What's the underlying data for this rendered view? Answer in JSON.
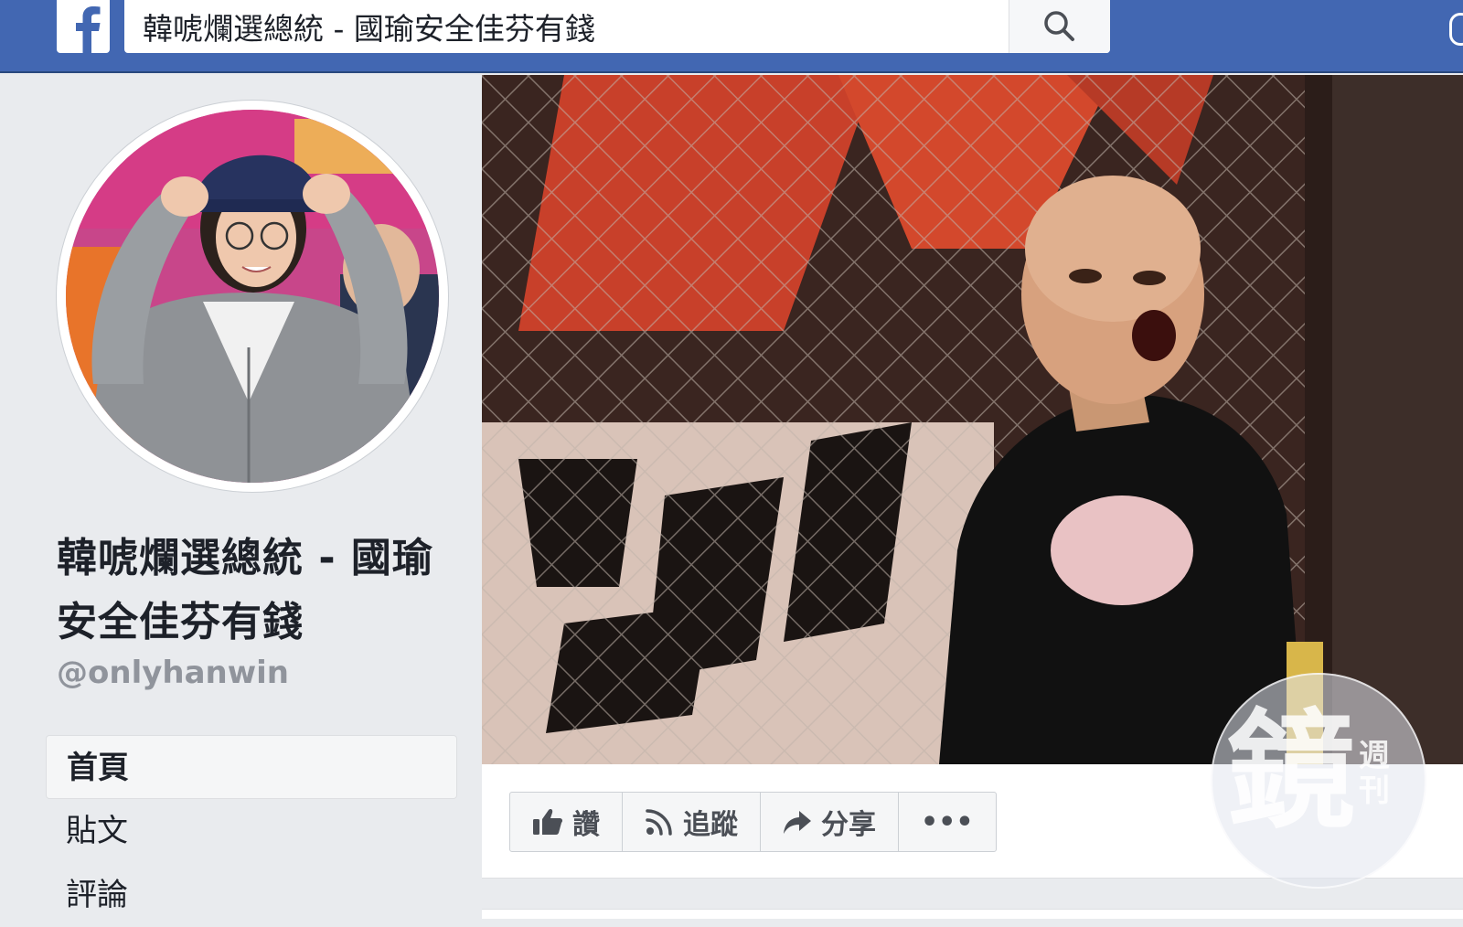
{
  "colors": {
    "brand": "#4267b2",
    "page_bg": "#e9ebee",
    "text": "#1d2129",
    "muted": "#90949c"
  },
  "topbar": {
    "logo_icon": "facebook-logo-icon",
    "search_value": "韓唬爛選總統 - 國瑜安全佳芬有錢",
    "search_icon": "search-icon"
  },
  "page": {
    "name": "韓唬爛選總統 - 國瑜安全佳芬有錢",
    "handle": "@onlyhanwin"
  },
  "nav": {
    "items": [
      {
        "label": "首頁",
        "active": true
      },
      {
        "label": "貼文",
        "active": false
      },
      {
        "label": "評論",
        "active": false
      }
    ]
  },
  "actions": {
    "like": {
      "label": "讚",
      "icon": "thumbs-up-icon"
    },
    "follow": {
      "label": "追蹤",
      "icon": "rss-icon"
    },
    "share": {
      "label": "分享",
      "icon": "share-arrow-icon"
    },
    "more": {
      "label": "•••",
      "icon": "more-dots-icon"
    }
  },
  "watermark": {
    "main": "鏡",
    "side": "週刊"
  }
}
